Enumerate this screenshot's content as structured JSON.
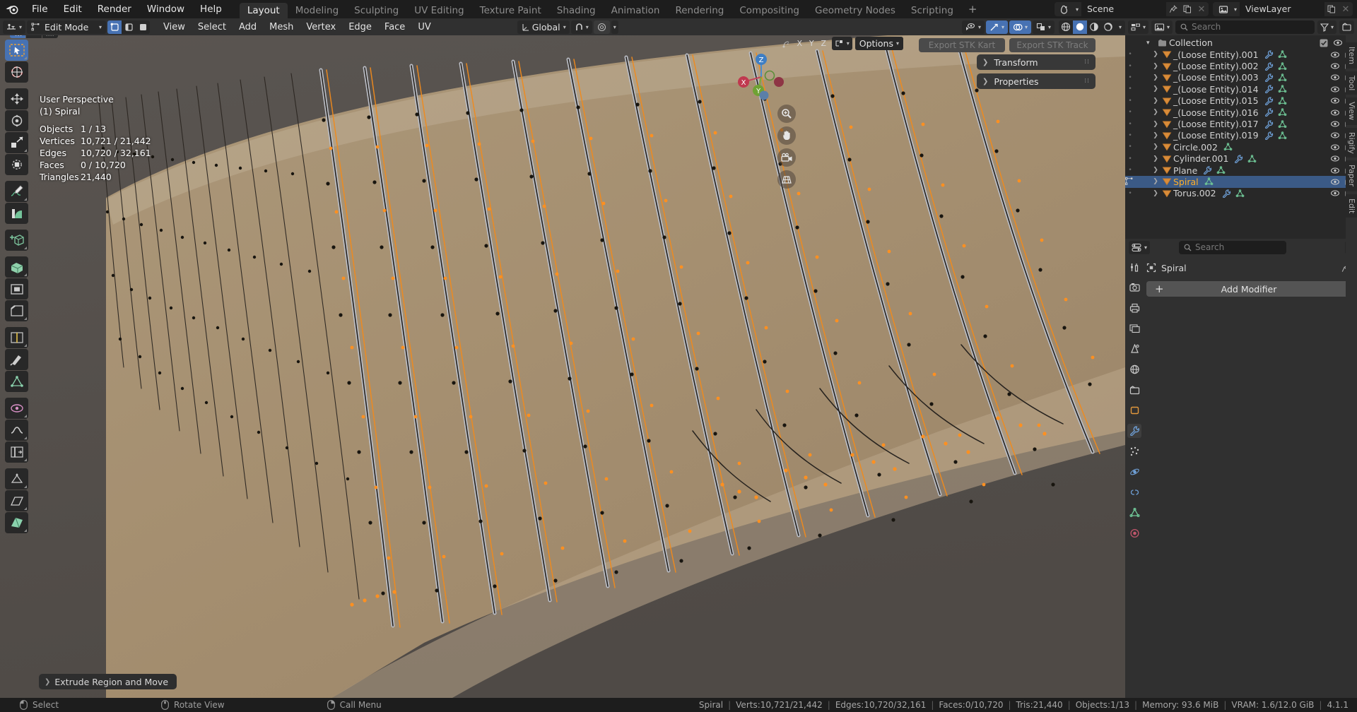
{
  "app": {
    "title": "Blender",
    "version": "4.1.1"
  },
  "topbar": {
    "menus": [
      "File",
      "Edit",
      "Render",
      "Window",
      "Help"
    ],
    "workspaces": [
      {
        "label": "Layout",
        "active": true
      },
      {
        "label": "Modeling",
        "active": false
      },
      {
        "label": "Sculpting",
        "active": false
      },
      {
        "label": "UV Editing",
        "active": false
      },
      {
        "label": "Texture Paint",
        "active": false
      },
      {
        "label": "Shading",
        "active": false
      },
      {
        "label": "Animation",
        "active": false
      },
      {
        "label": "Rendering",
        "active": false
      },
      {
        "label": "Compositing",
        "active": false
      },
      {
        "label": "Geometry Nodes",
        "active": false
      },
      {
        "label": "Scripting",
        "active": false
      }
    ],
    "add_workspace": "+",
    "scene": {
      "name": "Scene",
      "icon": "scene-icon"
    },
    "viewlayer": {
      "name": "ViewLayer",
      "icon": "viewlayer-icon"
    }
  },
  "viewport_header": {
    "editor_type_icon": "editor-type-icon",
    "mode": "Edit Mode",
    "select_modes": [
      "vertex-select-icon",
      "edge-select-icon",
      "face-select-icon"
    ],
    "select_mode_active": 0,
    "menus": [
      "View",
      "Select",
      "Add",
      "Mesh",
      "Vertex",
      "Edge",
      "Face",
      "UV"
    ],
    "transform_orientation": "Global",
    "snap_icon": "magnet-icon",
    "proportional_icon": "proportional-edit-icon",
    "visibility_icon": "visibility-icon",
    "gizmo_icon": "gizmo-icon",
    "overlays_icon": "overlays-icon",
    "xray_icon": "xray-icon",
    "shading_modes": [
      "wireframe-shading-icon",
      "solid-shading-icon",
      "material-shading-icon",
      "rendered-shading-icon"
    ],
    "shading_active": 1
  },
  "viewport_overlay": {
    "xyz_lock": [
      "X",
      "Y",
      "Z"
    ],
    "options_label": "Options",
    "view_label": "User Perspective",
    "active_object": "(1) Spiral",
    "stats": [
      {
        "label": "Objects",
        "value": "1 / 13"
      },
      {
        "label": "Vertices",
        "value": "10,721 / 21,442"
      },
      {
        "label": "Edges",
        "value": "10,720 / 32,161"
      },
      {
        "label": "Faces",
        "value": "0 / 10,720"
      },
      {
        "label": "Triangles",
        "value": "21,440"
      }
    ],
    "gizmo_axes": [
      "X",
      "Y",
      "Z"
    ],
    "nav_buttons": [
      "zoom-icon",
      "pan-hand-icon",
      "camera-view-icon",
      "toggle-perspective-icon"
    ],
    "operator_panel": "Extrude Region and Move"
  },
  "addon_buttons": [
    {
      "label": "Export STK Kart",
      "enabled": false
    },
    {
      "label": "Export STK Track",
      "enabled": false
    }
  ],
  "sidebar_panels": [
    {
      "label": "Transform",
      "expanded": false
    },
    {
      "label": "Properties",
      "expanded": false
    }
  ],
  "sidebar_tabs": [
    "Item",
    "Tool",
    "View",
    "Rigify",
    "Paper",
    "Edit"
  ],
  "toolbar": {
    "select_modes": [
      "tweak-select-icon",
      "box-select-icon",
      "lasso-select-icon"
    ],
    "tools": [
      {
        "name": "tweak-tool",
        "icon": "cursor-arrow-icon",
        "active": true
      },
      {
        "name": "cursor-tool",
        "icon": "3d-cursor-icon",
        "active": false
      },
      {
        "name": "move-tool",
        "icon": "move-arrows-icon",
        "active": false
      },
      {
        "name": "rotate-tool",
        "icon": "rotate-icon",
        "active": false
      },
      {
        "name": "scale-tool",
        "icon": "scale-icon",
        "active": false
      },
      {
        "name": "transform-tool",
        "icon": "transform-icon",
        "active": false
      },
      {
        "name": "annotate-tool",
        "icon": "pencil-icon",
        "active": false
      },
      {
        "name": "measure-tool",
        "icon": "ruler-icon",
        "active": false
      },
      {
        "name": "add-cube-tool",
        "icon": "add-cube-icon",
        "active": false
      },
      {
        "name": "extrude-region-tool",
        "icon": "extrude-icon",
        "active": false
      },
      {
        "name": "inset-faces-tool",
        "icon": "inset-faces-icon",
        "active": false
      },
      {
        "name": "bevel-tool",
        "icon": "bevel-icon",
        "active": false
      },
      {
        "name": "loop-cut-tool",
        "icon": "loop-cut-icon",
        "active": false
      },
      {
        "name": "knife-tool",
        "icon": "knife-icon",
        "active": false
      },
      {
        "name": "poly-build-tool",
        "icon": "poly-build-icon",
        "active": false
      },
      {
        "name": "spin-tool",
        "icon": "spin-icon",
        "active": false
      },
      {
        "name": "smooth-tool",
        "icon": "smooth-icon",
        "active": false
      },
      {
        "name": "edge-slide-tool",
        "icon": "edge-slide-icon",
        "active": false
      },
      {
        "name": "shrink-fatten-tool",
        "icon": "shrink-fatten-icon",
        "active": false
      },
      {
        "name": "shear-tool",
        "icon": "shear-icon",
        "active": false
      },
      {
        "name": "rip-region-tool",
        "icon": "rip-region-icon",
        "active": false
      }
    ]
  },
  "outliner": {
    "display_mode_icon": "outliner-display-mode-icon",
    "filter_icon": "filter-icon",
    "search_placeholder": "Search",
    "new_collection_icon": "new-collection-icon",
    "collection": {
      "label": "Collection",
      "checkbox": true
    },
    "items": [
      {
        "name": "_(Loose Entity).001",
        "modifier": true,
        "mesh": true,
        "selected": false
      },
      {
        "name": "_(Loose Entity).002",
        "modifier": true,
        "mesh": true,
        "selected": false
      },
      {
        "name": "_(Loose Entity).003",
        "modifier": true,
        "mesh": true,
        "selected": false
      },
      {
        "name": "_(Loose Entity).014",
        "modifier": true,
        "mesh": true,
        "selected": false
      },
      {
        "name": "_(Loose Entity).015",
        "modifier": true,
        "mesh": true,
        "selected": false
      },
      {
        "name": "_(Loose Entity).016",
        "modifier": true,
        "mesh": true,
        "selected": false
      },
      {
        "name": "_(Loose Entity).017",
        "modifier": true,
        "mesh": true,
        "selected": false
      },
      {
        "name": "_(Loose Entity).019",
        "modifier": true,
        "mesh": true,
        "selected": false
      },
      {
        "name": "Circle.002",
        "modifier": false,
        "mesh": true,
        "selected": false
      },
      {
        "name": "Cylinder.001",
        "modifier": true,
        "mesh": true,
        "selected": false
      },
      {
        "name": "Plane",
        "modifier": true,
        "mesh": true,
        "selected": false
      },
      {
        "name": "Spiral",
        "modifier": false,
        "mesh": true,
        "selected": true
      },
      {
        "name": "Torus.002",
        "modifier": true,
        "mesh": true,
        "selected": false
      }
    ]
  },
  "properties": {
    "editor_icon": "properties-editor-icon",
    "search_placeholder": "Search",
    "breadcrumb_object": "Spiral",
    "breadcrumb_icon": "object-icon",
    "pin_icon": "pin-icon",
    "add_modifier_label": "Add Modifier",
    "tabs": [
      {
        "name": "tool-tab",
        "icon": "tool-icon",
        "active": false
      },
      {
        "name": "render-tab",
        "icon": "render-camera-icon",
        "active": false
      },
      {
        "name": "output-tab",
        "icon": "printer-icon",
        "active": false
      },
      {
        "name": "viewlayer-tab",
        "icon": "images-icon",
        "active": false
      },
      {
        "name": "scene-tab",
        "icon": "scene-cone-icon",
        "active": false
      },
      {
        "name": "world-tab",
        "icon": "world-globe-icon",
        "active": false
      },
      {
        "name": "collection-tab",
        "icon": "collection-box-icon",
        "active": false
      },
      {
        "name": "object-tab",
        "icon": "object-square-icon",
        "active": false
      },
      {
        "name": "modifier-tab",
        "icon": "wrench-icon",
        "active": true
      },
      {
        "name": "particles-tab",
        "icon": "particles-icon",
        "active": false
      },
      {
        "name": "physics-tab",
        "icon": "physics-orbit-icon",
        "active": false
      },
      {
        "name": "constraints-tab",
        "icon": "constraints-icon",
        "active": false
      },
      {
        "name": "data-tab",
        "icon": "mesh-data-triangle-icon",
        "active": false
      },
      {
        "name": "material-tab",
        "icon": "material-sphere-icon",
        "active": false
      }
    ]
  },
  "statusbar": {
    "keymap": [
      {
        "icon": "mouse-left-icon",
        "label": "Select"
      },
      {
        "icon": "mouse-middle-icon",
        "label": "Rotate View"
      },
      {
        "icon": "mouse-right-icon",
        "label": "Call Menu"
      }
    ],
    "scene_stats": [
      "Spiral",
      "Verts:10,721/21,442",
      "Edges:10,720/32,161",
      "Faces:0/10,720",
      "Tris:21,440",
      "Objects:1/13",
      "Memory: 93.6 MiB",
      "VRAM: 1.6/12.0 GiB",
      "4.1.1"
    ]
  },
  "colors": {
    "accent_blue": "#4772b3",
    "select_orange": "#ffaf29",
    "header_bg": "#303030",
    "editor_bg": "#282828",
    "viewport_mesh": "#a18a6c",
    "row_select": "#3b5a86"
  }
}
